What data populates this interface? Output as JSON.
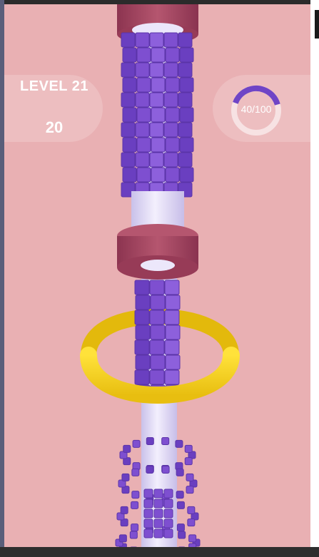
{
  "hud": {
    "level_label": "LEVEL 21",
    "score": "20",
    "progress_text": "40/100",
    "progress_fraction": 0.4
  },
  "colors": {
    "background": "#e9b0b3",
    "cube_purple": "#7e4fd0",
    "pole_lavender": "#ded8f3",
    "cap_maroon": "#a84a63",
    "ring_yellow": "#f4d21e",
    "ring_progress": "#6f45c6"
  },
  "icons": {
    "ring": "yellow-ring"
  }
}
